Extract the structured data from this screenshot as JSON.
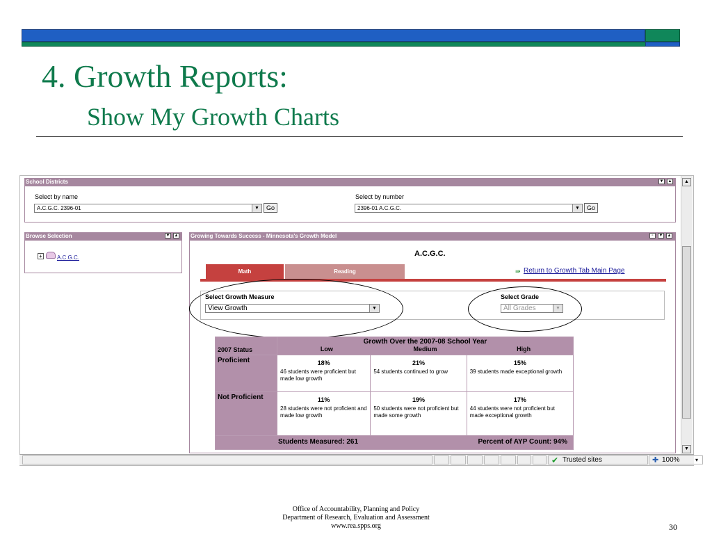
{
  "slide": {
    "title": "4.  Growth Reports:",
    "subtitle": "Show My Growth Charts",
    "footer_lines": [
      "Office of Accountability, Planning and Policy",
      "Department of Research, Evaluation and Assessment",
      "www.rea.spps.org"
    ],
    "page_number": "30"
  },
  "school_districts": {
    "header": "School Districts",
    "by_name_label": "Select by name",
    "by_name_value": "A.C.G.C. 2396-01",
    "by_number_label": "Select by number",
    "by_number_value": "2396-01 A.C.G.C.",
    "go_label": "Go"
  },
  "browse": {
    "header": "Browse Selection",
    "tree_item": "A.C.G.C."
  },
  "growth_panel": {
    "header": "Growing Towards Success - Minnesota's Growth Model",
    "school_name": "A.C.G.C.",
    "tabs": [
      "Math",
      "Reading"
    ],
    "return_link": "Return to Growth Tab Main Page",
    "measure_label": "Select Growth Measure",
    "measure_value": "View Growth",
    "grade_label": "Select Grade",
    "grade_value": "All Grades"
  },
  "growth_table": {
    "title": "Growth Over the 2007-08 School Year",
    "status_header": "2007 Status",
    "columns": [
      "Low",
      "Medium",
      "High"
    ],
    "rows": [
      {
        "label": "Proficient",
        "cells": [
          {
            "pct": "18%",
            "text": "46 students were proficient but made low growth"
          },
          {
            "pct": "21%",
            "text": "54 students continued to grow"
          },
          {
            "pct": "15%",
            "text": "39 students made exceptional growth"
          }
        ]
      },
      {
        "label": "Not Proficient",
        "cells": [
          {
            "pct": "11%",
            "text": "28 students were not proficient and made low growth"
          },
          {
            "pct": "19%",
            "text": "50 students were not proficient but made some growth"
          },
          {
            "pct": "17%",
            "text": "44 students were not proficient but made exceptional growth"
          }
        ]
      }
    ],
    "students_measured": "Students Measured: 261",
    "ayp_count": "Percent of AYP Count: 94%"
  },
  "statusbar": {
    "trusted": "Trusted sites",
    "zoom": "100%"
  }
}
